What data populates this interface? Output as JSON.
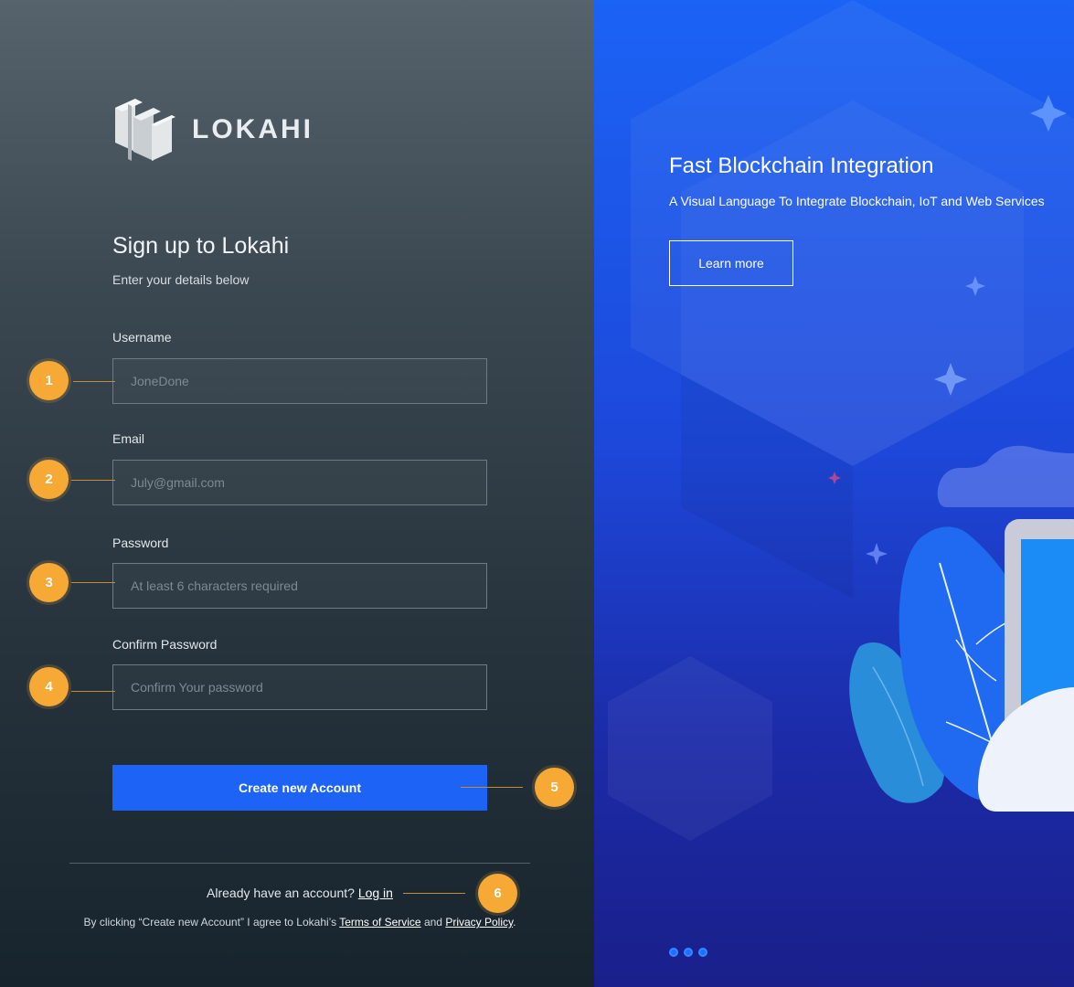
{
  "brand": {
    "name": "LOKAHI"
  },
  "form": {
    "title": "Sign up to Lokahi",
    "subtitle": "Enter your details below",
    "username": {
      "label": "Username",
      "placeholder": "JoneDone",
      "value": ""
    },
    "email": {
      "label": "Email",
      "placeholder": "July@gmail.com",
      "value": ""
    },
    "password": {
      "label": "Password",
      "placeholder": "At least 6 characters required",
      "value": ""
    },
    "confirm": {
      "label": "Confirm Password",
      "placeholder": "Confirm Your password",
      "value": ""
    },
    "submit_label": "Create new Account"
  },
  "footer": {
    "have_account": "Already have an account?",
    "login_link": "Log in",
    "terms_prefix": "By clicking “Create new Account” I agree to Lokahi’s",
    "terms_link": "Terms of Service",
    "and": "and",
    "privacy_link": "Privacy Policy",
    "period": "."
  },
  "annotations": [
    "1",
    "2",
    "3",
    "4",
    "5",
    "6"
  ],
  "hero": {
    "title": "Fast Blockchain Integration",
    "subtitle": "A Visual Language To Integrate Blockchain, IoT and Web Services",
    "button_label": "Learn more",
    "slide_count": 3
  },
  "colors": {
    "accent": "#1c63f6",
    "badge": "#f7a936",
    "hero_top": "#1b63f5",
    "hero_bottom": "#1a1f8a"
  }
}
